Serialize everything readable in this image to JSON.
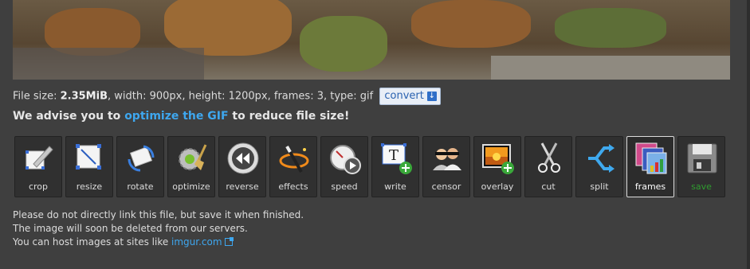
{
  "file_info": {
    "prefix": "File size: ",
    "size": "2.35MiB",
    "rest": ", width: 900px, height: 1200px, frames: 3, type: gif",
    "convert_label": "convert"
  },
  "advice": {
    "pre": "We advise you to ",
    "link": "optimize the GIF",
    "post": " to reduce file size!"
  },
  "tools": [
    {
      "label": "crop",
      "icon": "crop-icon"
    },
    {
      "label": "resize",
      "icon": "resize-icon"
    },
    {
      "label": "rotate",
      "icon": "rotate-icon"
    },
    {
      "label": "optimize",
      "icon": "optimize-icon"
    },
    {
      "label": "reverse",
      "icon": "reverse-icon"
    },
    {
      "label": "effects",
      "icon": "effects-icon"
    },
    {
      "label": "speed",
      "icon": "speed-icon"
    },
    {
      "label": "write",
      "icon": "write-icon"
    },
    {
      "label": "censor",
      "icon": "censor-icon"
    },
    {
      "label": "overlay",
      "icon": "overlay-icon"
    },
    {
      "label": "cut",
      "icon": "scissors-icon"
    },
    {
      "label": "split",
      "icon": "split-icon"
    },
    {
      "label": "frames",
      "icon": "frames-icon"
    },
    {
      "label": "save",
      "icon": "floppy-disk-icon"
    }
  ],
  "active_tool": "frames",
  "notes": {
    "line1": "Please do not directly link this file, but save it when finished.",
    "line2": "The image will soon be deleted from our servers.",
    "line3_pre": "You can host images at sites like ",
    "line3_link": "imgur.com"
  },
  "colors": {
    "background": "#3f3f3f",
    "link": "#3ea7ef",
    "save_label": "#2f9d2f"
  }
}
